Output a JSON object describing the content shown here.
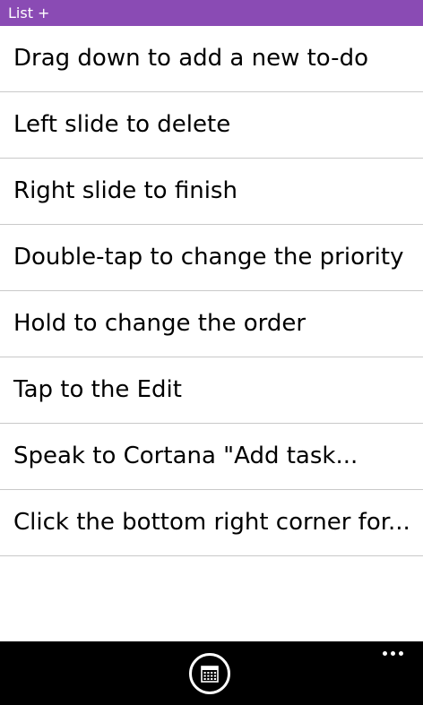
{
  "colors": {
    "accent": "#8a4bb4",
    "list_text": "#000000",
    "divider": "#c9c9c9",
    "appbar_bg": "#000000",
    "appbar_fg": "#ffffff"
  },
  "header": {
    "title": "List +"
  },
  "list": {
    "items": [
      {
        "label": "Drag down to add a new to-do"
      },
      {
        "label": "Left slide to delete"
      },
      {
        "label": "Right slide to finish"
      },
      {
        "label": "Double-tap to change the priority"
      },
      {
        "label": "Hold to change the order"
      },
      {
        "label": "Tap to the Edit"
      },
      {
        "label": "Speak to Cortana \"Add task..."
      },
      {
        "label": "Click the bottom right corner for..."
      }
    ]
  },
  "appbar": {
    "primary_icon": "calendar-icon",
    "more_icon": "more-icon"
  }
}
